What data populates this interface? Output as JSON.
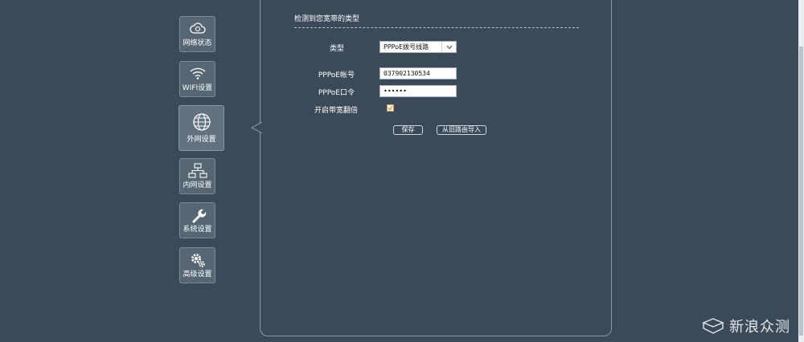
{
  "nav": [
    {
      "label": "网络状态",
      "icon": "cloud-network-icon"
    },
    {
      "label": "WIFI设置",
      "icon": "wifi-icon"
    },
    {
      "label": "外网设置",
      "icon": "globe-icon"
    },
    {
      "label": "内网设置",
      "icon": "lan-topology-icon"
    },
    {
      "label": "系统设置",
      "icon": "wrench-icon"
    },
    {
      "label": "高级设置",
      "icon": "gears-icon"
    }
  ],
  "active_nav": "外网设置",
  "main": {
    "section_title": "检测到您宽带的类型",
    "type_label": "类型",
    "type_value": "PPPoE拨号线路",
    "account_label": "PPPoE帐号",
    "account_value": "037902130534",
    "password_label": "PPPoE口令",
    "password_value": "••••••",
    "bandwidth_label": "开启带宽翻倍",
    "bandwidth_checked": true,
    "save_label": "保存",
    "import_label": "从旧路由导入"
  },
  "watermark": "新浪众测",
  "colors": {
    "background": "#3a4a58",
    "checkbox_accent": "#d4a34f"
  }
}
